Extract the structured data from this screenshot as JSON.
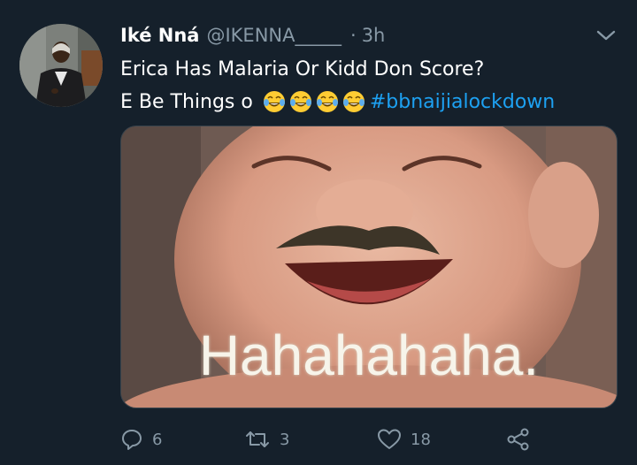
{
  "tweet": {
    "author_name": "Iké Nná",
    "handle": "@IKENNA_____",
    "separator": "·",
    "time": "3h",
    "text_line1": "Erica Has Malaria Or Kidd Don Score?",
    "text_line2": "E Be Things o",
    "emojis": [
      "joy-emoji",
      "joy-emoji",
      "joy-emoji",
      "joy-emoji"
    ],
    "hashtag": "#bbnaijialockdown",
    "media_caption": "Hahahahaha."
  },
  "actions": {
    "reply_count": "6",
    "retweet_count": "3",
    "like_count": "18"
  },
  "icons": {
    "reply": "reply-icon",
    "retweet": "retweet-icon",
    "like": "heart-icon",
    "share": "share-icon",
    "menu": "chevron-down-icon"
  },
  "colors": {
    "background": "#15202b",
    "text": "#ffffff",
    "secondary": "#8899a6",
    "link": "#1da1f2"
  }
}
